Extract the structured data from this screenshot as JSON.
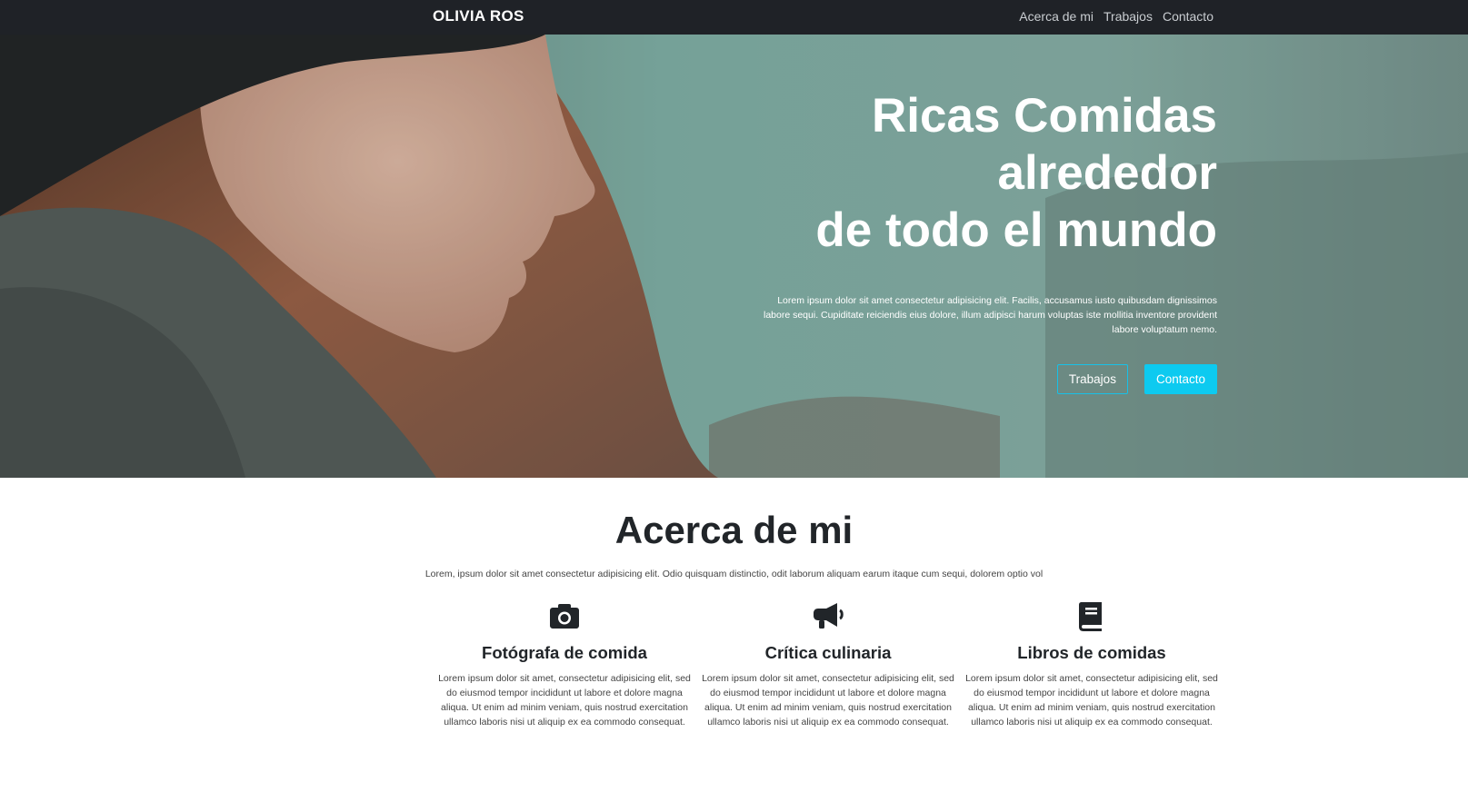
{
  "navbar": {
    "brand": "OLIVIA ROS",
    "links": [
      "Acerca de mi",
      "Trabajos",
      "Contacto"
    ]
  },
  "hero": {
    "title_lines": [
      "Ricas Comidas",
      "alrededor",
      "de todo el mundo"
    ],
    "text": "Lorem ipsum dolor sit amet consectetur adipisicing elit. Facilis, accusamus iusto quibusdam dignissimos labore sequi. Cupiditate reiciendis eius dolore, illum adipisci harum voluptas iste mollitia inventore provident labore voluptatum nemo.",
    "buttons": {
      "outline": "Trabajos",
      "solid": "Contacto"
    }
  },
  "about": {
    "title": "Acerca de mi",
    "lead": "Lorem, ipsum dolor sit amet consectetur adipisicing elit. Odio quisquam distinctio, odit laborum aliquam earum itaque cum sequi, dolorem optio vol",
    "features": [
      {
        "icon": "camera-icon",
        "title": "Fotógrafa de comida",
        "text": "Lorem ipsum dolor sit amet, consectetur adipisicing elit, sed do eiusmod tempor incididunt ut labore et dolore magna aliqua. Ut enim ad minim veniam, quis nostrud exercitation ullamco laboris nisi ut aliquip ex ea commodo consequat."
      },
      {
        "icon": "megaphone-icon",
        "title": "Crítica culinaria",
        "text": "Lorem ipsum dolor sit amet, consectetur adipisicing elit, sed do eiusmod tempor incididunt ut labore et dolore magna aliqua. Ut enim ad minim veniam, quis nostrud exercitation ullamco laboris nisi ut aliquip ex ea commodo consequat."
      },
      {
        "icon": "book-icon",
        "title": "Libros de comidas",
        "text": "Lorem ipsum dolor sit amet, consectetur adipisicing elit, sed do eiusmod tempor incididunt ut labore et dolore magna aliqua. Ut enim ad minim veniam, quis nostrud exercitation ullamco laboris nisi ut aliquip ex ea commodo consequat."
      }
    ]
  },
  "colors": {
    "navbar_bg": "#1f2227",
    "accent": "#0dcaf0",
    "text_dark": "#212529"
  }
}
